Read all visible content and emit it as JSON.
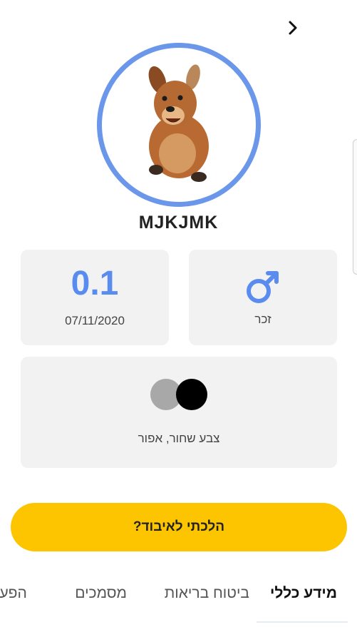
{
  "header": {
    "back_icon": "chevron-right-icon"
  },
  "pet": {
    "name": "MJKJMK",
    "photo": "dog-photo",
    "ring_color": "#6a97ea"
  },
  "stats": {
    "weight": "0.1",
    "date": "07/11/2020",
    "gender_icon": "male-symbol-icon",
    "gender_label": "זכר",
    "colors": [
      "#a8a8a8",
      "#000000"
    ],
    "color_label": "צבע שחור, אפור"
  },
  "actions": {
    "lost_button": "הלכתי לאיבוד?"
  },
  "tabs": [
    {
      "label": "מידע כללי",
      "active": true
    },
    {
      "label": "ביטוח בריאות",
      "active": false
    },
    {
      "label": "מסמכים",
      "active": false
    },
    {
      "label": "הפעי",
      "active": false
    }
  ],
  "theme": {
    "accent": "#5a8cf0",
    "button_yellow": "#fdc500",
    "card_bg": "#f2f2f2"
  }
}
